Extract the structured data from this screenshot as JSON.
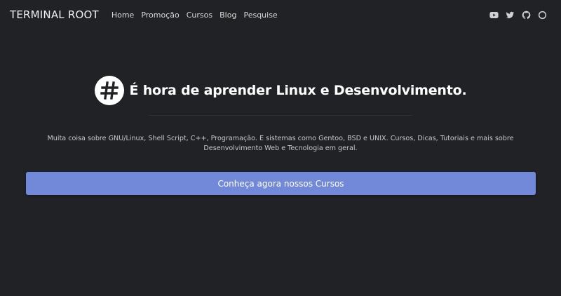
{
  "header": {
    "brand": "TERMINAL ROOT",
    "nav": [
      {
        "label": "Home"
      },
      {
        "label": "Promoção"
      },
      {
        "label": "Cursos"
      },
      {
        "label": "Blog"
      },
      {
        "label": "Pesquise"
      }
    ],
    "social_icons": [
      "youtube-icon",
      "twitter-icon",
      "github-icon",
      "circle-icon"
    ]
  },
  "hero": {
    "logo_icon": "hash-logo-icon",
    "title": "É hora de aprender Linux e Desenvolvimento.",
    "lead": "Muita coisa sobre GNU/Linux, Shell Script, C++, Programação. E sistemas como Gentoo, BSD e UNIX. Cursos, Dicas, Tutoriais e mais sobre Desenvolvimento Web e Tecnologia em geral.",
    "cta_label": "Conheça agora nossos Cursos"
  },
  "colors": {
    "background": "#212226",
    "accent": "#7289da",
    "text": "#ffffff"
  }
}
